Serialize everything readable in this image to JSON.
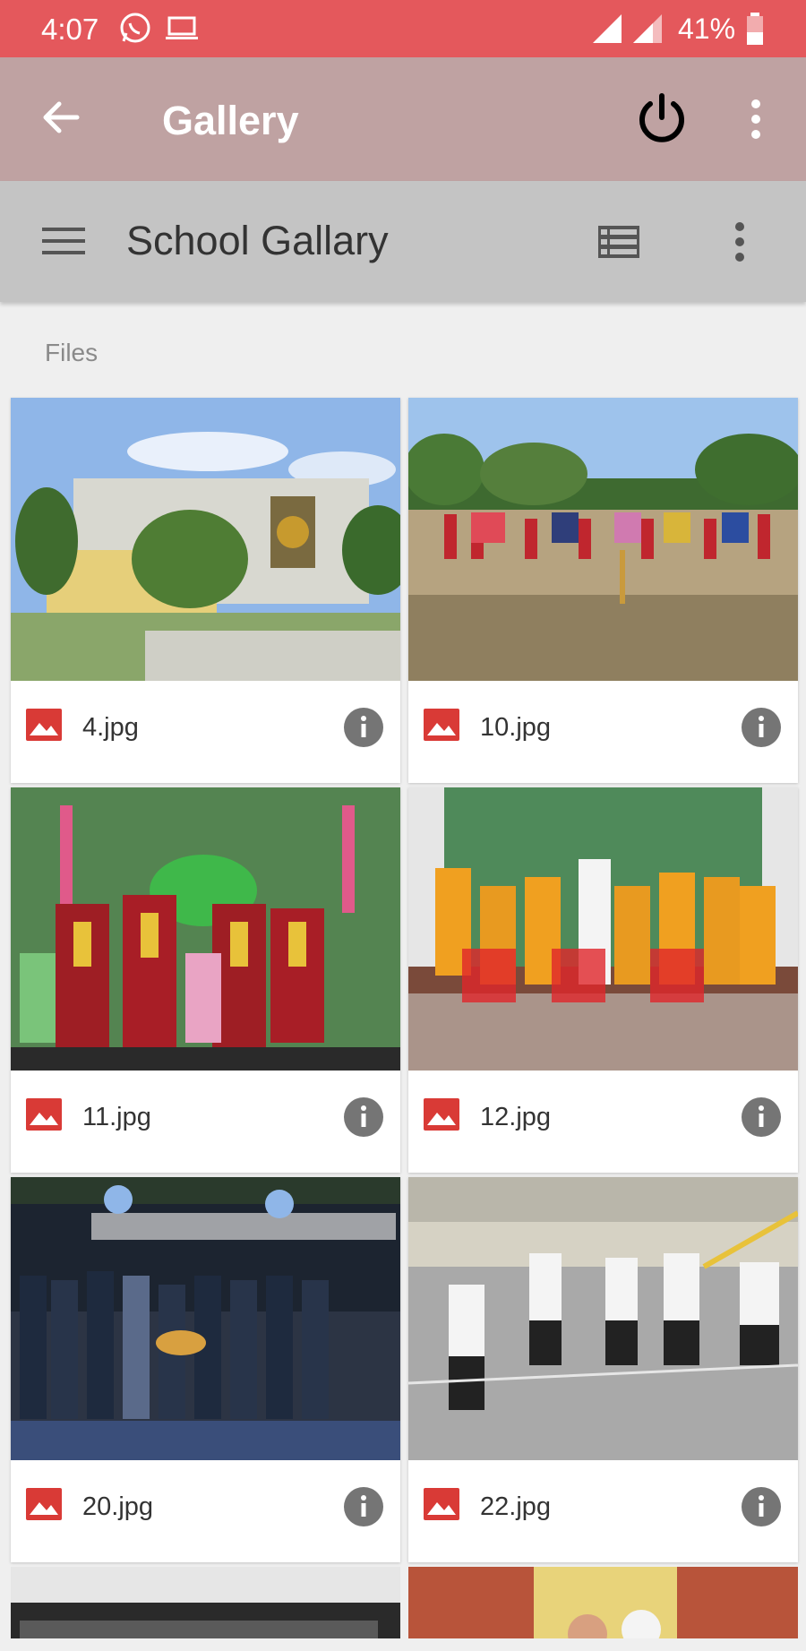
{
  "status_bar": {
    "time": "4:07",
    "battery": "41%",
    "icons": [
      "whatsapp-icon",
      "laptop-icon",
      "signal-icon",
      "signal-icon",
      "battery-icon"
    ]
  },
  "app_bar": {
    "title": "Gallery"
  },
  "sub_bar": {
    "title": "School Gallary"
  },
  "section_label": "Files",
  "files": [
    {
      "name": "4.jpg"
    },
    {
      "name": "10.jpg"
    },
    {
      "name": "11.jpg"
    },
    {
      "name": "12.jpg"
    },
    {
      "name": "20.jpg"
    },
    {
      "name": "22.jpg"
    }
  ],
  "colors": {
    "status_bar": "#e4585c",
    "app_bar": "#bfa2a2",
    "sub_bar": "#c4c4c4",
    "file_icon": "#d93a36",
    "info_icon": "#757575"
  }
}
